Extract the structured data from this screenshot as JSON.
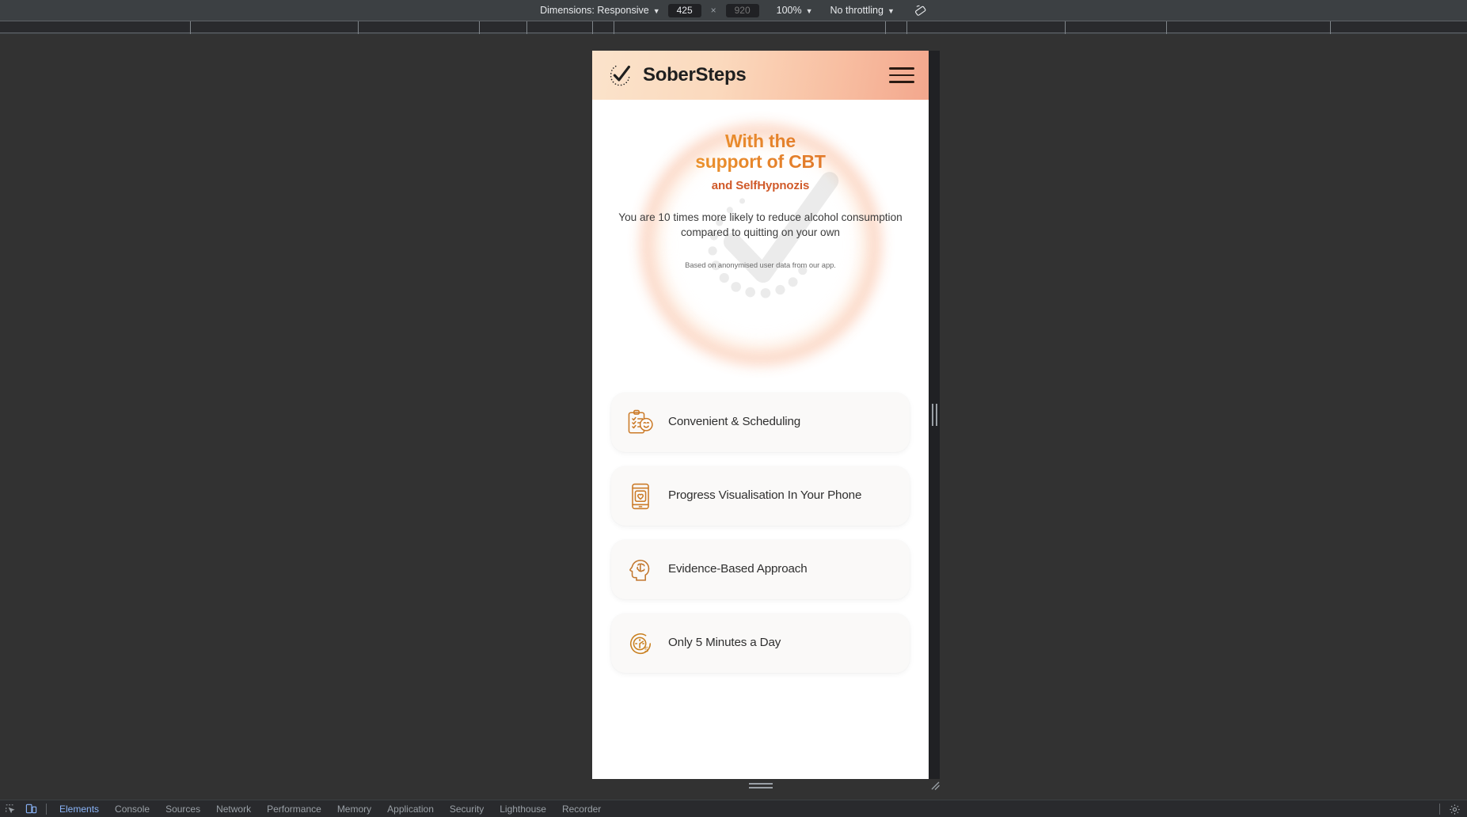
{
  "devtools": {
    "emulation_toolbar": {
      "dimensions_label": "Dimensions: Responsive",
      "width_value": "425",
      "height_placeholder": "920",
      "separator": "×",
      "zoom_label": "100%",
      "throttling_label": "No throttling",
      "rotate_icon": "rotate-device-icon"
    },
    "tabs": [
      {
        "label": "Elements",
        "active": true
      },
      {
        "label": "Console",
        "active": false
      },
      {
        "label": "Sources",
        "active": false
      },
      {
        "label": "Network",
        "active": false
      },
      {
        "label": "Performance",
        "active": false
      },
      {
        "label": "Memory",
        "active": false
      },
      {
        "label": "Application",
        "active": false
      },
      {
        "label": "Security",
        "active": false
      },
      {
        "label": "Lighthouse",
        "active": false
      },
      {
        "label": "Recorder",
        "active": false
      }
    ],
    "left_icons": [
      {
        "name": "inspect-element-icon"
      },
      {
        "name": "toggle-device-toolbar-icon"
      }
    ],
    "settings_icon": "gear-icon"
  },
  "page": {
    "header": {
      "logo_icon": "checkmark-dotted-circle-logo",
      "title": "SoberSteps",
      "menu_icon": "hamburger-menu-icon",
      "gradient_from": "#fbe3cb",
      "gradient_to": "#f3a78d"
    },
    "hero": {
      "title_line_1": "With the",
      "title_line_2": "support of CBT",
      "subtitle": "and SelfHypnozis",
      "body": "You are 10 times more likely to reduce alcohol consumption compared to quitting on your own",
      "caption": "Based on anonymised user data from our app.",
      "accent_color": "#e08a2b",
      "subtitle_color": "#d05a2a",
      "glow_color": "#f68b56",
      "watermark_icon": "checkmark-dotted-circle-watermark"
    },
    "features": [
      {
        "icon": "clipboard-smiley-icon",
        "label": "Convenient & Scheduling"
      },
      {
        "icon": "phone-heart-icon",
        "label": "Progress Visualisation In Your Phone"
      },
      {
        "icon": "head-brain-icon",
        "label": "Evidence-Based Approach"
      },
      {
        "icon": "clock-five-minutes-icon",
        "label": "Only 5 Minutes a Day"
      }
    ]
  }
}
